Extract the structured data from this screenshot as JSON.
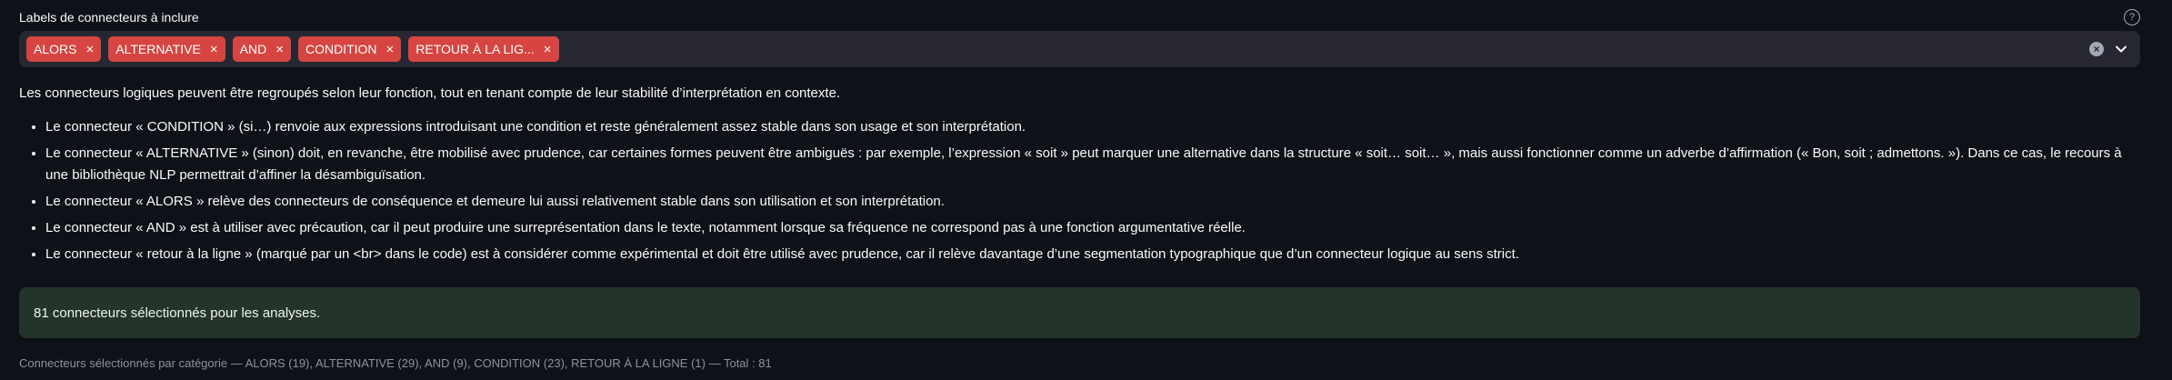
{
  "multiselect": {
    "label": "Labels de connecteurs à inclure",
    "help_icon": "question-circle-icon",
    "tags": [
      {
        "label": "ALORS",
        "close": "×"
      },
      {
        "label": "ALTERNATIVE",
        "close": "×"
      },
      {
        "label": "AND",
        "close": "×"
      },
      {
        "label": "CONDITION",
        "close": "×"
      },
      {
        "label": "RETOUR À LA LIG...",
        "close": "×"
      }
    ],
    "clear_icon": "clear-all-icon",
    "chevron_icon": "chevron-down-icon",
    "tag_color": "#d64541"
  },
  "description": {
    "intro": "Les connecteurs logiques peuvent être regroupés selon leur fonction, tout en tenant compte de leur stabilité d’interprétation en contexte.",
    "bullets": [
      "Le connecteur « CONDITION » (si…) renvoie aux expressions introduisant une condition et reste généralement assez stable dans son usage et son interprétation.",
      "Le connecteur « ALTERNATIVE » (sinon) doit, en revanche, être mobilisé avec prudence, car certaines formes peuvent être ambiguës : par exemple, l’expression « soit » peut marquer une alternative dans la structure « soit… soit… », mais aussi fonctionner comme un adverbe d’affirmation (« Bon, soit ; admettons. »). Dans ce cas, le recours à une bibliothèque NLP permettrait d’affiner la désambiguïsation.",
      "Le connecteur « ALORS » relève des connecteurs de conséquence et demeure lui aussi relativement stable dans son utilisation et son interprétation.",
      "Le connecteur « AND » est à utiliser avec précaution, car il peut produire une surreprésentation dans le texte, notamment lorsque sa fréquence ne correspond pas à une fonction argumentative réelle.",
      "Le connecteur « retour à la ligne » (marqué par un <br> dans le code) est à considérer comme expérimental et doit être utilisé avec prudence, car il relève davantage d’une segmentation typographique que d’un connecteur logique au sens strict."
    ]
  },
  "success": {
    "message": "81 connecteurs sélectionnés pour les analyses.",
    "color": "#24342a"
  },
  "caption": {
    "text": "Connecteurs sélectionnés par catégorie — ALORS (19), ALTERNATIVE (29), AND (9), CONDITION (23), RETOUR À LA LIGNE (1) — Total : 81"
  }
}
